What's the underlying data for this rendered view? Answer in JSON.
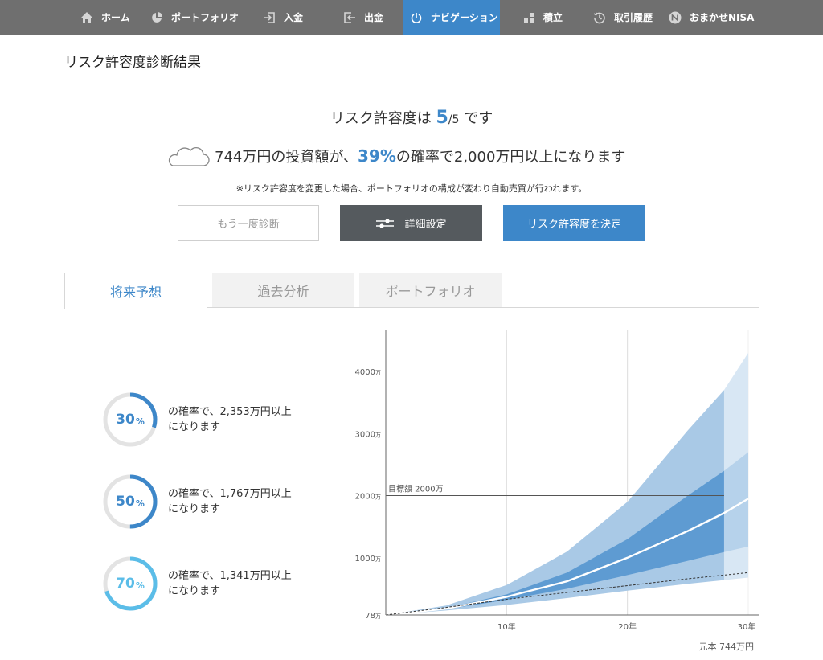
{
  "nav": {
    "items": [
      {
        "label": "ホーム",
        "icon": "home-icon"
      },
      {
        "label": "ポートフォリオ",
        "icon": "pie-chart-icon"
      },
      {
        "label": "入金",
        "icon": "deposit-icon"
      },
      {
        "label": "出金",
        "icon": "withdraw-icon"
      },
      {
        "label": "ナビゲーション",
        "icon": "power-icon",
        "active": true
      },
      {
        "label": "積立",
        "icon": "blocks-icon"
      },
      {
        "label": "取引履歴",
        "icon": "history-icon"
      },
      {
        "label": "おまかせNISA",
        "icon": "nisa-icon"
      }
    ]
  },
  "page": {
    "title": "リスク許容度診断結果",
    "risk_prefix": "リスク許容度は ",
    "risk_value": "5",
    "risk_slash": "/",
    "risk_max": "5",
    "risk_suffix": " です",
    "result_prefix": "744万円の投資額が、",
    "result_pct": "39%",
    "result_suffix": "の確率で2,000万円以上になります",
    "note": "※リスク許容度を変更した場合、ポートフォリオの構成が変わり自動売買が行われます。"
  },
  "buttons": {
    "retry": "もう一度診断",
    "detail": "詳細設定",
    "decide": "リスク許容度を決定"
  },
  "tabs": [
    {
      "label": "将来予想",
      "active": true
    },
    {
      "label": "過去分析"
    },
    {
      "label": "ポートフォリオ"
    }
  ],
  "gauges": [
    {
      "value": "30",
      "unit": "%",
      "fraction": 0.3,
      "color": "#3d87c9",
      "line1": "の確率で、2,353万円以上",
      "line2": "になります"
    },
    {
      "value": "50",
      "unit": "%",
      "fraction": 0.5,
      "color": "#3d87c9",
      "line1": "の確率で、1,767万円以上",
      "line2": "になります"
    },
    {
      "value": "70",
      "unit": "%",
      "fraction": 0.7,
      "color": "#5bbde8",
      "line1": "の確率で、1,341万円以上",
      "line2": "になります"
    }
  ],
  "chart_data": {
    "type": "area",
    "x_ticks": [
      {
        "value": 10,
        "label": "10年"
      },
      {
        "value": 20,
        "label": "20年"
      },
      {
        "value": 30,
        "label": "30年"
      }
    ],
    "y_ticks": [
      {
        "value": 78,
        "num": "78",
        "unit": "万"
      },
      {
        "value": 1000,
        "num": "1000",
        "unit": "万"
      },
      {
        "value": 2000,
        "num": "2000",
        "unit": "万"
      },
      {
        "value": 3000,
        "num": "3000",
        "unit": "万"
      },
      {
        "value": 4000,
        "num": "4000",
        "unit": "万"
      }
    ],
    "xlim": [
      0,
      30
    ],
    "ylim": [
      78,
      4700
    ],
    "target": {
      "value": 2000,
      "label": "目標額 2000万"
    },
    "principal_label": "元本 744万円",
    "x": [
      0,
      5,
      10,
      15,
      20,
      25,
      28,
      30
    ],
    "outer_upper": [
      78,
      230,
      560,
      1100,
      1900,
      3050,
      3700,
      4300
    ],
    "outer_lower": [
      78,
      150,
      240,
      350,
      470,
      580,
      640,
      680
    ],
    "inner_upper": [
      78,
      190,
      410,
      760,
      1300,
      2000,
      2400,
      2700
    ],
    "inner_lower": [
      78,
      170,
      320,
      500,
      720,
      950,
      1090,
      1180
    ],
    "median": [
      78,
      180,
      370,
      620,
      1000,
      1430,
      1720,
      1950
    ],
    "principal": [
      78,
      200,
      330,
      440,
      550,
      660,
      720,
      760
    ],
    "colors": {
      "outer": "#a9c9e6",
      "inner": "#5e9bd2",
      "median": "#ffffff",
      "projection_fade": "#e3eef8"
    }
  }
}
